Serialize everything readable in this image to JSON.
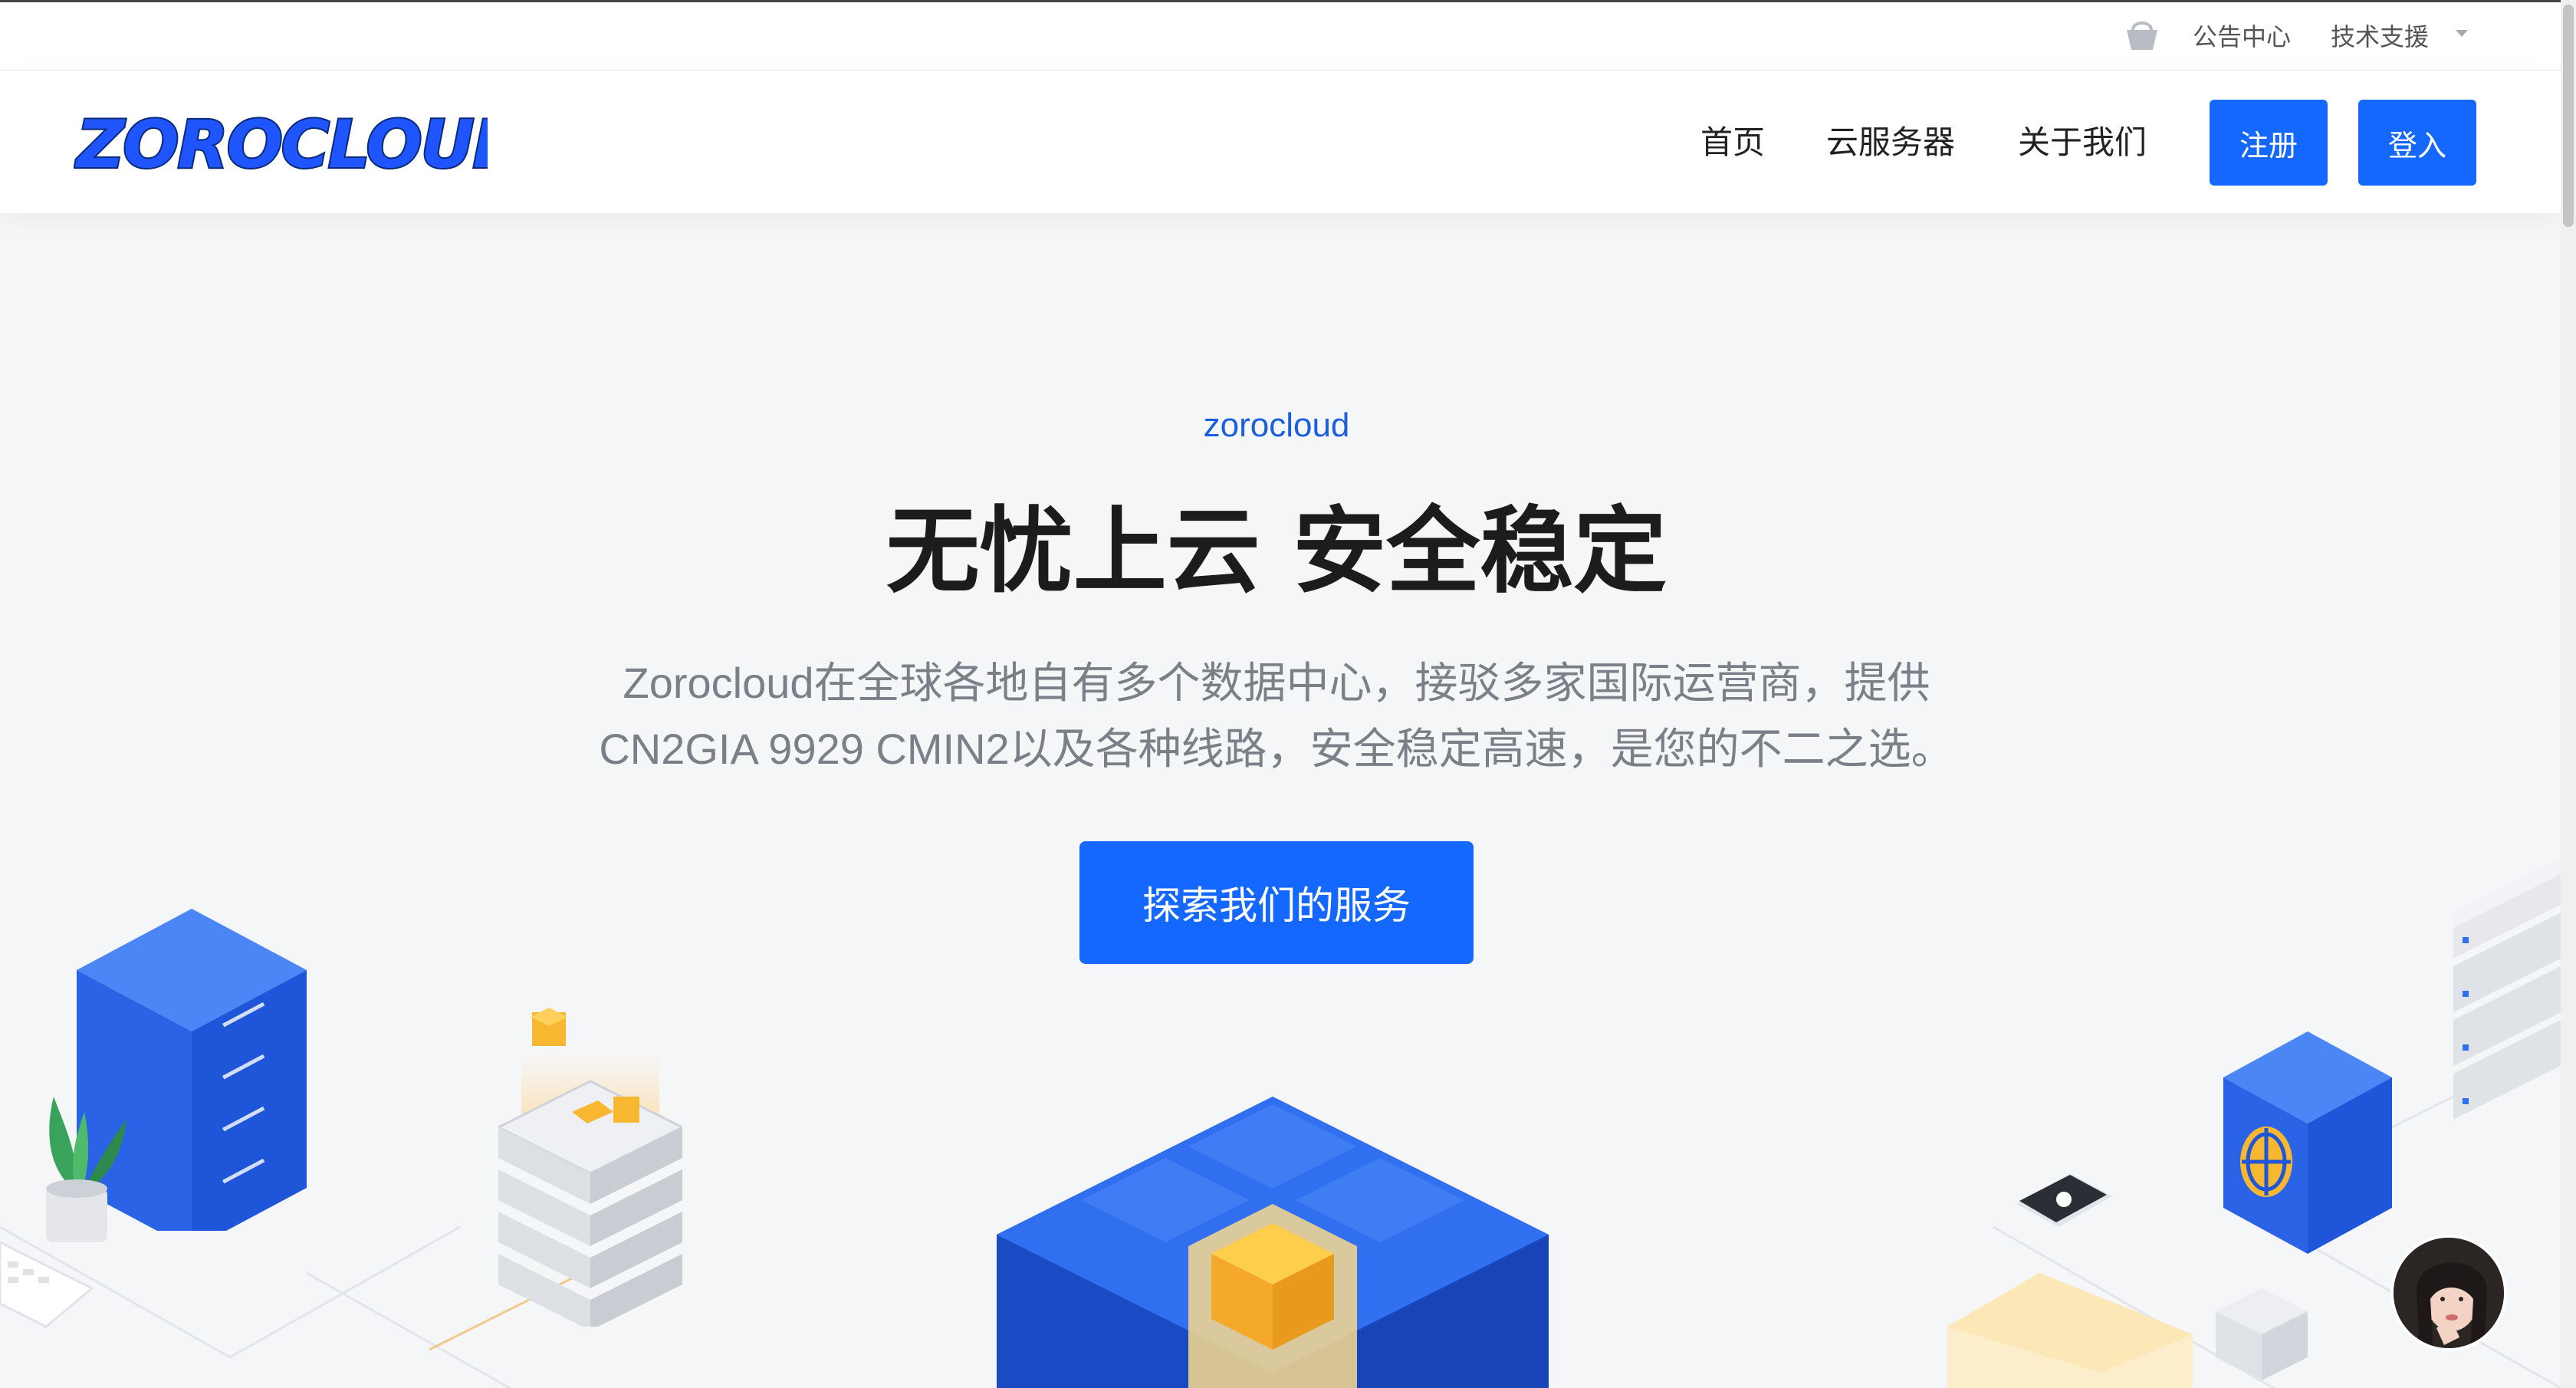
{
  "topbar": {
    "notice": "公告中心",
    "support": "技术支援"
  },
  "nav": {
    "logo_text": "ZOROCLOUD",
    "links": [
      "首页",
      "云服务器",
      "关于我们"
    ],
    "register": "注册",
    "login": "登入"
  },
  "hero": {
    "eyebrow": "zorocloud",
    "title": "无忧上云 安全稳定",
    "desc_line1": "Zorocloud在全球各地自有多个数据中心，接驳多家国际运营商，提供",
    "desc_line2": "CN2GIA 9929 CMIN2以及各种线路，安全稳定高速，是您的不二之选。",
    "cta": "探索我们的服务"
  },
  "colors": {
    "accent": "#1468ff",
    "eyebrow": "#1a5fe0",
    "server_blue": "#2f6ff0",
    "cube_gold": "#f7b731"
  },
  "icons": [
    "basket-icon",
    "caret-down-icon",
    "globe-icon",
    "plant-icon",
    "server-rack-icon",
    "cube-icon"
  ]
}
